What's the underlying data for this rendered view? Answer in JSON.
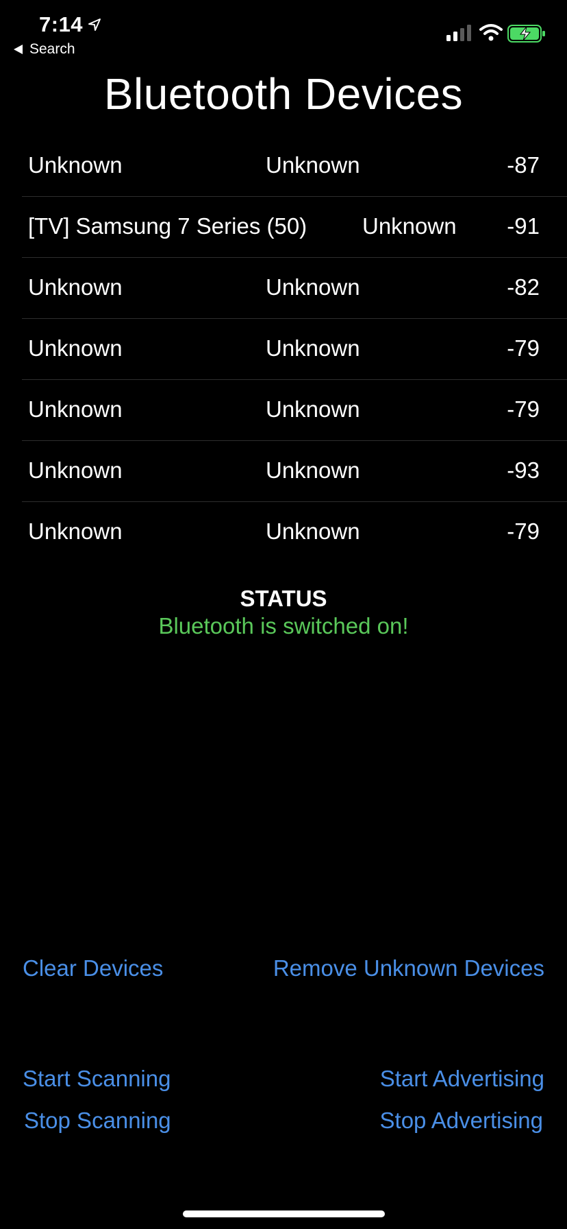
{
  "status_bar": {
    "time": "7:14",
    "back_label": "Search"
  },
  "page": {
    "title": "Bluetooth Devices"
  },
  "devices": [
    {
      "name": "Unknown",
      "uuid": "Unknown",
      "rssi": "-87"
    },
    {
      "name": "[TV] Samsung 7 Series (50)",
      "uuid": "Unknown",
      "rssi": "-91"
    },
    {
      "name": "Unknown",
      "uuid": "Unknown",
      "rssi": "-82"
    },
    {
      "name": "Unknown",
      "uuid": "Unknown",
      "rssi": "-79"
    },
    {
      "name": "Unknown",
      "uuid": "Unknown",
      "rssi": "-79"
    },
    {
      "name": "Unknown",
      "uuid": "Unknown",
      "rssi": "-93"
    },
    {
      "name": "Unknown",
      "uuid": "Unknown",
      "rssi": "-79"
    }
  ],
  "status": {
    "heading": "STATUS",
    "message": "Bluetooth is switched on!"
  },
  "actions": {
    "clear_devices": "Clear Devices",
    "remove_unknown": "Remove Unknown Devices",
    "start_scanning": "Start Scanning",
    "stop_scanning": "Stop Scanning",
    "start_advertising": "Start Advertising",
    "stop_advertising": "Stop Advertising"
  },
  "colors": {
    "background": "#000000",
    "text": "#ffffff",
    "link": "#4a8fe7",
    "status_ok": "#5ac85a",
    "battery_charging": "#4cd964"
  },
  "icons": {
    "location": "location-arrow-icon",
    "back": "back-arrow-icon",
    "signal": "cellular-signal-icon",
    "wifi": "wifi-icon",
    "battery": "battery-charging-icon"
  },
  "signal_bars_active": 2,
  "signal_bars_total": 4
}
